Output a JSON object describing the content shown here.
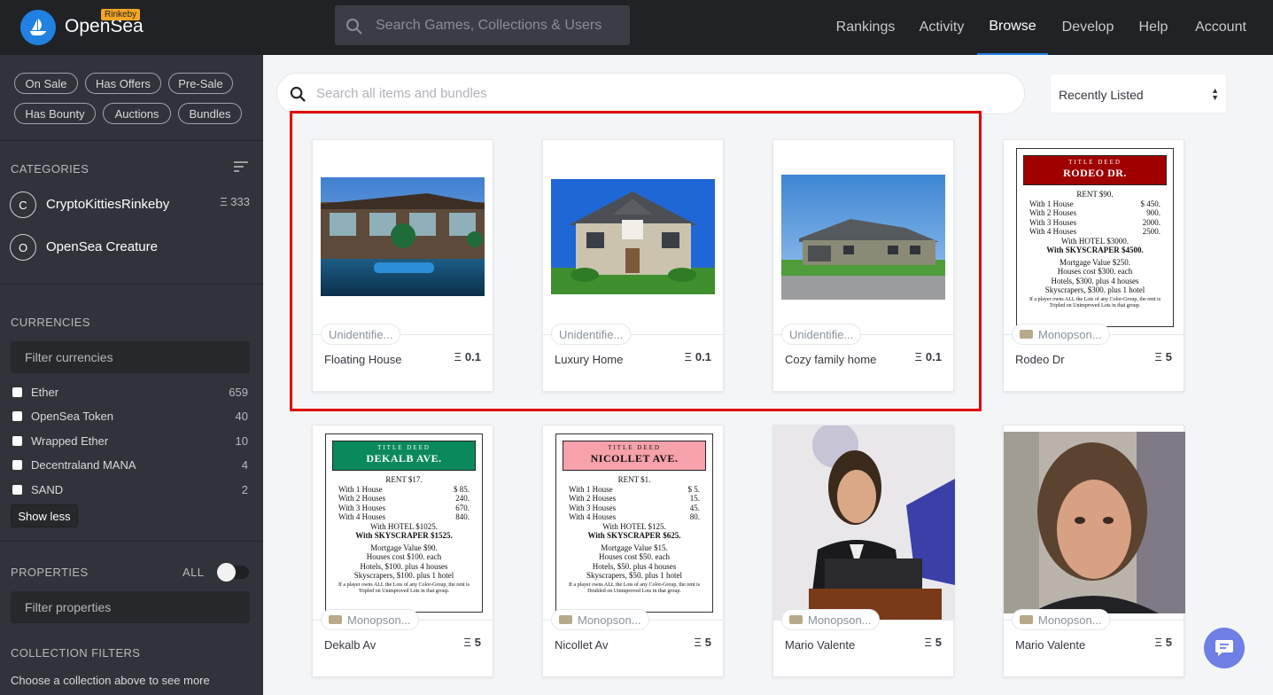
{
  "app": {
    "brand": "OpenSea",
    "network_badge": "Rinkeby"
  },
  "header": {
    "search_placeholder": "Search Games, Collections & Users",
    "nav": [
      "Rankings",
      "Activity",
      "Browse",
      "Develop",
      "Help",
      "Account"
    ],
    "active_nav": "Browse"
  },
  "sidebar": {
    "filters": [
      "On Sale",
      "Has Offers",
      "Pre-Sale",
      "Has Bounty",
      "Auctions",
      "Bundles"
    ],
    "categories_title": "CATEGORIES",
    "categories": [
      {
        "initial": "C",
        "name": "CryptoKittiesRinkeby",
        "count": "Ξ 333"
      },
      {
        "initial": "O",
        "name": "OpenSea Creature",
        "count": ""
      }
    ],
    "currencies_title": "CURRENCIES",
    "currency_filter_placeholder": "Filter currencies",
    "currencies": [
      {
        "name": "Ether",
        "count": "659"
      },
      {
        "name": "OpenSea Token",
        "count": "40"
      },
      {
        "name": "Wrapped Ether",
        "count": "10"
      },
      {
        "name": "Decentraland MANA",
        "count": "4"
      },
      {
        "name": "SAND",
        "count": "2"
      }
    ],
    "show_less": "Show less",
    "properties_title": "PROPERTIES",
    "properties_all": "ALL",
    "properties_filter_placeholder": "Filter properties",
    "collection_filters_title": "COLLECTION FILTERS",
    "collection_filters_hint": "Choose a collection above to see more"
  },
  "main": {
    "search_placeholder": "Search all items and bundles",
    "sort": "Recently Listed",
    "eth_symbol": "Ξ",
    "cards": [
      {
        "collection": "Unidentifie...",
        "name": "Floating House",
        "price": "0.1",
        "image": "houseboat-photo"
      },
      {
        "collection": "Unidentifie...",
        "name": "Luxury Home",
        "price": "0.1",
        "image": "luxury-house-photo"
      },
      {
        "collection": "Unidentifie...",
        "name": "Cozy family home",
        "price": "0.1",
        "image": "family-house-photo"
      },
      {
        "collection": "Monopson...",
        "name": "Rodeo Dr",
        "price": "5",
        "image": "rodeo-deed"
      },
      {
        "collection": "Monopson...",
        "name": "Dekalb Av",
        "price": "5",
        "image": "dekalb-deed"
      },
      {
        "collection": "Monopson...",
        "name": "Nicollet Av",
        "price": "5",
        "image": "nicollet-deed"
      },
      {
        "collection": "Monopson...",
        "name": "Mario Valente",
        "price": "5",
        "image": "speaker-photo"
      },
      {
        "collection": "Monopson...",
        "name": "Mario Valente",
        "price": "5",
        "image": "selfie-photo"
      }
    ],
    "deeds": [
      {
        "label": "TITLE DEED",
        "street": "RODEO DR.",
        "color": "#a00000",
        "rent": "RENT $90.",
        "rows": [
          [
            "With 1 House",
            "$   450."
          ],
          [
            "With 2 Houses",
            "900."
          ],
          [
            "With 3 Houses",
            "2000."
          ],
          [
            "With 4 Houses",
            "2500."
          ]
        ],
        "hotel": "With HOTEL $3000.",
        "skyscraper": "With SKYSCRAPER $4500.",
        "mortgage": "Mortgage Value $250.",
        "houses": "Houses cost $300. each",
        "hotels": "Hotels, $300. plus 4 houses",
        "skyscrapers": "Skyscrapers, $300. plus 1 hotel",
        "fine": "If a player owns ALL the Lots of any Color-Group, the rent is Tripled on Unimproved Lots in that group."
      },
      {
        "label": "TITLE DEED",
        "street": "DEKALB AVE.",
        "color": "#0a8a5a",
        "rent": "RENT $17.",
        "rows": [
          [
            "With 1 House",
            "$   85."
          ],
          [
            "With 2 Houses",
            "240."
          ],
          [
            "With 3 Houses",
            "670."
          ],
          [
            "With 4 Houses",
            "840."
          ]
        ],
        "hotel": "With HOTEL $1025.",
        "skyscraper": "With SKYSCRAPER $1525.",
        "mortgage": "Mortgage Value $90.",
        "houses": "Houses cost $100. each",
        "hotels": "Hotels, $100. plus 4 houses",
        "skyscrapers": "Skyscrapers, $100. plus 1 hotel",
        "fine": "If a player owns ALL the Lots of any Color-Group, the rent is Tripled on Unimproved Lots in that group."
      },
      {
        "label": "TITLE DEED",
        "street": "NICOLLET AVE.",
        "color": "#f7a1aa",
        "rent": "RENT $1.",
        "rows": [
          [
            "With 1 House",
            "$   5."
          ],
          [
            "With 2 Houses",
            "15."
          ],
          [
            "With 3 Houses",
            "45."
          ],
          [
            "With 4 Houses",
            "80."
          ]
        ],
        "hotel": "With HOTEL $125.",
        "skyscraper": "With SKYSCRAPER $625.",
        "mortgage": "Mortgage Value $15.",
        "houses": "Houses cost $50. each",
        "hotels": "Hotels, $50. plus 4 houses",
        "skyscrapers": "Skyscrapers, $50. plus 1 hotel",
        "fine": "If a player owns ALL the Lots of any Color-Group, the rent is Doubled on Unimproved Lots in that group."
      }
    ]
  },
  "colors": {
    "accent": "#2081e2",
    "highlight": "#e00000",
    "header_bg": "#202225",
    "sidebar_bg": "#303339"
  }
}
